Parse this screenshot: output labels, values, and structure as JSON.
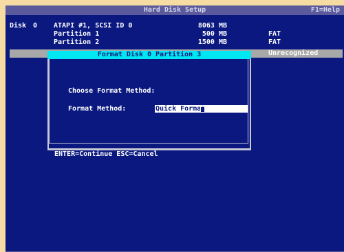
{
  "header": {
    "title": "Hard Disk Setup",
    "help": "F1=Help"
  },
  "disk": {
    "label": "Disk",
    "number": "0",
    "name": "ATAPI #1, SCSI ID 0",
    "size": "8063 MB"
  },
  "partitions": [
    {
      "name": "Partition 1",
      "size": "500 MB",
      "fs": "FAT"
    },
    {
      "name": "Partition 2",
      "size": "1500 MB",
      "fs": "FAT"
    },
    {
      "name": "",
      "size": "",
      "fs": "Unrecognized"
    }
  ],
  "dialog": {
    "title": "Format Disk 0 Partition 3",
    "prompt": "Choose Format Method:",
    "field_label": "Format Method:",
    "field_value": "Quick Format",
    "footer": "ENTER=Continue  ESC=Cancel"
  },
  "colors": {
    "screen": "#0a1880",
    "titlebar": "#5a5a9c",
    "dialog_title": "#00e6f2",
    "highlight_row": "#a8a8a8",
    "outer": "#f6dca3"
  }
}
